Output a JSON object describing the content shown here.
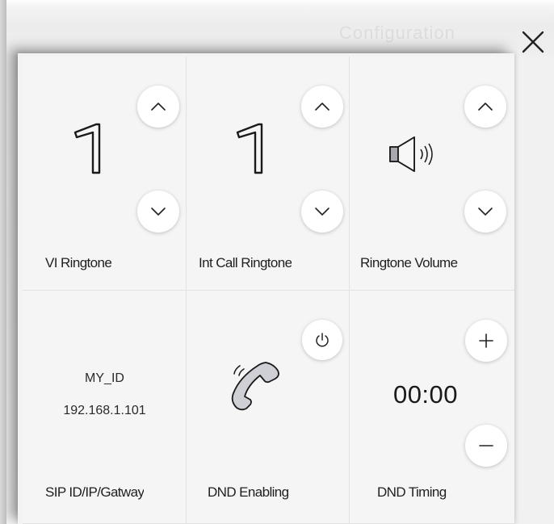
{
  "backdrop": {
    "title": "Configuration"
  },
  "dialog": {
    "close_icon": "close-icon"
  },
  "tiles": [
    {
      "label": "VI Ringtone",
      "value": "1",
      "icons": [
        "chevron-up-icon",
        "chevron-down-icon"
      ]
    },
    {
      "label": "Int Call Ringtone",
      "value": "1",
      "icons": [
        "chevron-up-icon",
        "chevron-down-icon"
      ]
    },
    {
      "label": "Ringtone Volume",
      "icons": [
        "speaker-icon",
        "chevron-up-icon",
        "chevron-down-icon"
      ]
    },
    {
      "label": "SIP ID/IP/Gatway",
      "sip_id": "MY_ID",
      "ip": "192.168.1.101"
    },
    {
      "label": "DND Enabling",
      "icons": [
        "power-icon",
        "phone-icon"
      ]
    },
    {
      "label": "DND Timing",
      "value": "00:00",
      "icons": [
        "plus-icon",
        "minus-icon"
      ]
    }
  ],
  "colors": {
    "panel": "#f5f5f5",
    "button": "#ffffff",
    "text": "#1f1f1f"
  }
}
